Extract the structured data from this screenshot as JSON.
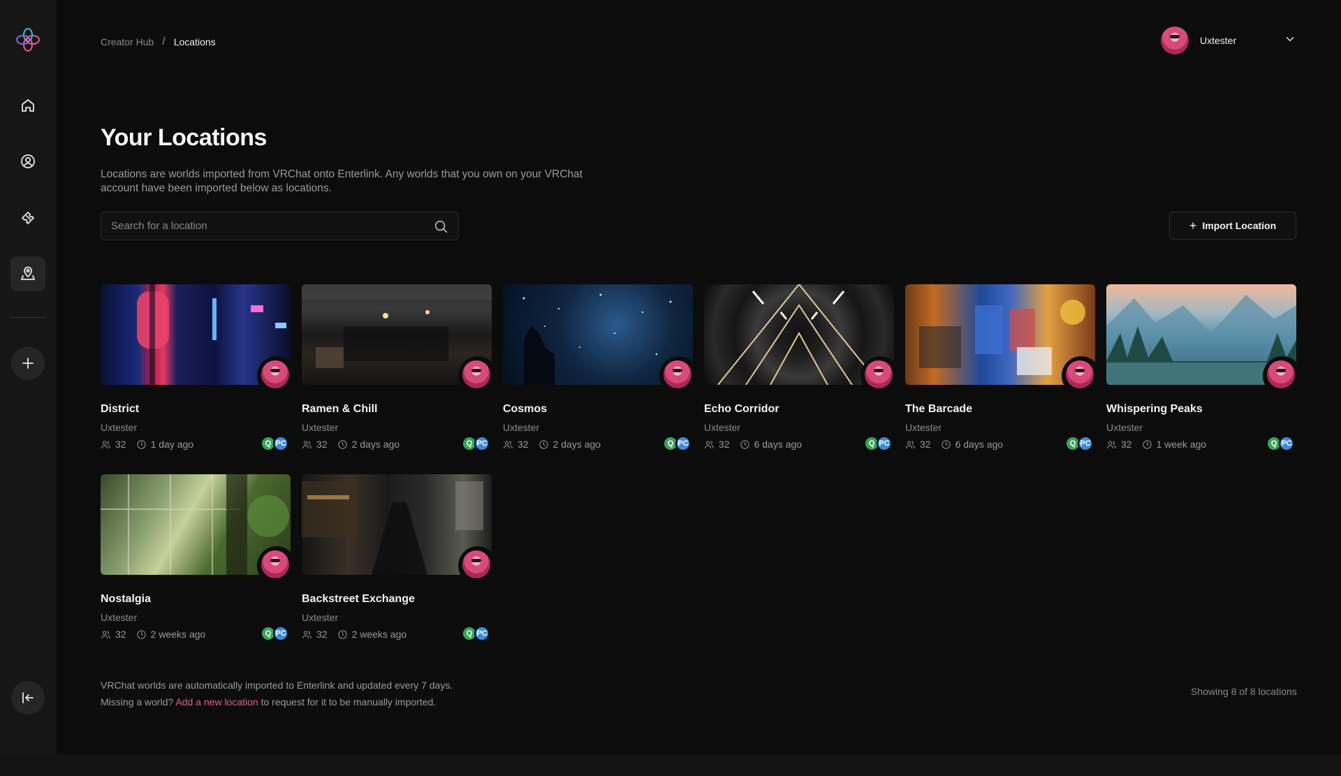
{
  "breadcrumb": {
    "root": "Creator Hub",
    "separator": "/",
    "current": "Locations"
  },
  "user": {
    "name": "Uxtester"
  },
  "page": {
    "title": "Your Locations",
    "description": "Locations are worlds imported from VRChat onto Enterlink. Any worlds that you own on your VRChat account have been imported below as locations."
  },
  "search": {
    "placeholder": "Search for a location",
    "value": ""
  },
  "import_button": {
    "label": "Import Location"
  },
  "locations": [
    {
      "title": "District",
      "owner": "Uxtester",
      "members": "32",
      "updated": "1 day ago",
      "platforms": [
        "Q",
        "PC"
      ]
    },
    {
      "title": "Ramen & Chill",
      "owner": "Uxtester",
      "members": "32",
      "updated": "2 days ago",
      "platforms": [
        "Q",
        "PC"
      ]
    },
    {
      "title": "Cosmos",
      "owner": "Uxtester",
      "members": "32",
      "updated": "2 days ago",
      "platforms": [
        "Q",
        "PC"
      ]
    },
    {
      "title": "Echo Corridor",
      "owner": "Uxtester",
      "members": "32",
      "updated": "6 days ago",
      "platforms": [
        "Q",
        "PC"
      ]
    },
    {
      "title": "The Barcade",
      "owner": "Uxtester",
      "members": "32",
      "updated": "6 days ago",
      "platforms": [
        "Q",
        "PC"
      ]
    },
    {
      "title": "Whispering Peaks",
      "owner": "Uxtester",
      "members": "32",
      "updated": "1 week ago",
      "platforms": [
        "Q",
        "PC"
      ]
    },
    {
      "title": "Nostalgia",
      "owner": "Uxtester",
      "members": "32",
      "updated": "2 weeks ago",
      "platforms": [
        "Q",
        "PC"
      ]
    },
    {
      "title": "Backstreet Exchange",
      "owner": "Uxtester",
      "members": "32",
      "updated": "2 weeks ago",
      "platforms": [
        "Q",
        "PC"
      ]
    }
  ],
  "footer": {
    "line1": "VRChat worlds are automatically imported to Enterlink and updated every 7 days.",
    "line2_prefix": "Missing a world?",
    "line2_link": "Add a new location",
    "line2_suffix": "to request for it to be manually imported.",
    "showing": "Showing 8 of 8 locations"
  },
  "sidebar": {
    "items": [
      {
        "icon": "home-icon"
      },
      {
        "icon": "profile-icon"
      },
      {
        "icon": "ticket-icon"
      },
      {
        "icon": "location-pin-icon",
        "active": true
      }
    ]
  },
  "colors": {
    "background": "#0c0c0c",
    "sidebar": "#161616",
    "accent_link": "#e0608c",
    "quest_badge": "#3aa35a",
    "pc_badge": "#3d8bd9"
  }
}
